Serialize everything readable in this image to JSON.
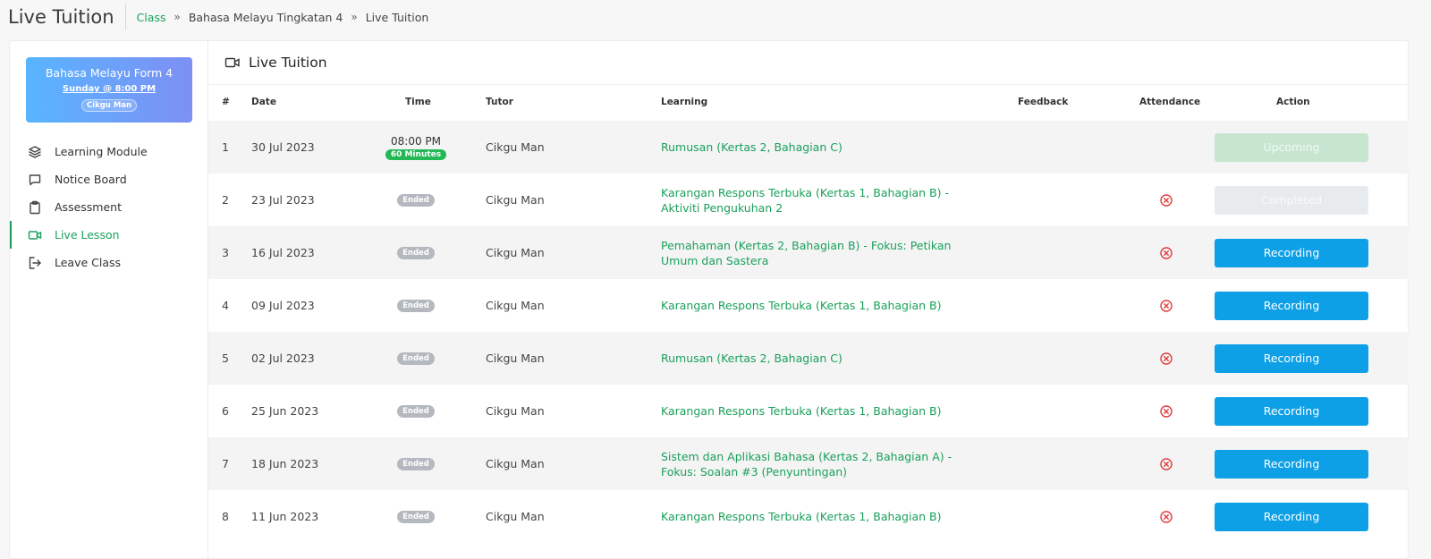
{
  "page": {
    "title": "Live Tuition"
  },
  "breadcrumb": {
    "items": [
      "Class",
      "Bahasa Melayu Tingkatan 4",
      "Live Tuition"
    ],
    "separator": "»"
  },
  "class_card": {
    "name": "Bahasa Melayu Form 4",
    "schedule": "Sunday @ 8:00 PM",
    "tutor": "Cikgu Man"
  },
  "menu": {
    "items": [
      {
        "label": "Learning Module",
        "icon": "layers-icon"
      },
      {
        "label": "Notice Board",
        "icon": "chat-icon"
      },
      {
        "label": "Assessment",
        "icon": "clipboard-icon"
      },
      {
        "label": "Live Lesson",
        "icon": "video-icon",
        "active": true
      },
      {
        "label": "Leave Class",
        "icon": "logout-icon"
      }
    ]
  },
  "main": {
    "title": "Live Tuition",
    "icon": "video-icon"
  },
  "table": {
    "headers": {
      "num": "#",
      "date": "Date",
      "time": "Time",
      "tutor": "Tutor",
      "learning": "Learning",
      "feedback": "Feedback",
      "attendance": "Attendance",
      "action": "Action"
    },
    "rows": [
      {
        "num": "1",
        "date": "30 Jul 2023",
        "time": "08:00 PM",
        "duration": "60 Minutes",
        "tutor": "Cikgu Man",
        "learning": "Rumusan (Kertas 2, Bahagian C)",
        "action": "Upcoming"
      },
      {
        "num": "2",
        "date": "23 Jul 2023",
        "status": "Ended",
        "tutor": "Cikgu Man",
        "learning": "Karangan Respons Terbuka (Kertas 1, Bahagian B) - Aktiviti Pengukuhan 2",
        "action": "Completed"
      },
      {
        "num": "3",
        "date": "16 Jul 2023",
        "status": "Ended",
        "tutor": "Cikgu Man",
        "learning": "Pemahaman (Kertas 2, Bahagian B) - Fokus: Petikan Umum dan Sastera",
        "action": "Recording"
      },
      {
        "num": "4",
        "date": "09 Jul 2023",
        "status": "Ended",
        "tutor": "Cikgu Man",
        "learning": "Karangan Respons Terbuka (Kertas 1, Bahagian B)",
        "action": "Recording"
      },
      {
        "num": "5",
        "date": "02 Jul 2023",
        "status": "Ended",
        "tutor": "Cikgu Man",
        "learning": "Rumusan (Kertas 2, Bahagian C)",
        "action": "Recording"
      },
      {
        "num": "6",
        "date": "25 Jun 2023",
        "status": "Ended",
        "tutor": "Cikgu Man",
        "learning": "Karangan Respons Terbuka (Kertas 1, Bahagian B)",
        "action": "Recording"
      },
      {
        "num": "7",
        "date": "18 Jun 2023",
        "status": "Ended",
        "tutor": "Cikgu Man",
        "learning": "Sistem dan Aplikasi Bahasa (Kertas 2, Bahagian A) - Fokus: Soalan #3 (Penyuntingan)",
        "action": "Recording"
      },
      {
        "num": "8",
        "date": "11 Jun 2023",
        "status": "Ended",
        "tutor": "Cikgu Man",
        "learning": "Karangan Respons Terbuka (Kertas 1, Bahagian B)",
        "action": "Recording"
      }
    ]
  },
  "colors": {
    "accent": "#1aa05a",
    "recording": "#0ea0e6",
    "absent": "#e03b3b"
  }
}
